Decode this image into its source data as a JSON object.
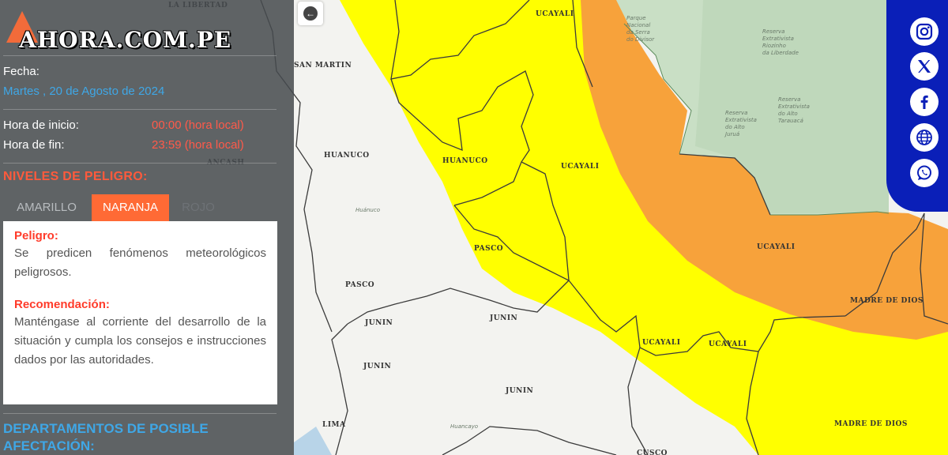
{
  "brand": {
    "logo_text": "AHORA.COM.PE"
  },
  "fecha": {
    "label": "Fecha:",
    "value": "Martes , 20 de Agosto de 2024"
  },
  "hora_inicio": {
    "label": "Hora de inicio:",
    "value": "00:00 (hora local)"
  },
  "hora_fin": {
    "label": "Hora de fin:",
    "value": "23:59 (hora local)"
  },
  "niveles": {
    "title": "NIVELES DE PELIGRO:",
    "tabs": [
      {
        "label": "AMARILLO"
      },
      {
        "label": "NARANJA"
      },
      {
        "label": "ROJO"
      }
    ],
    "active": "NARANJA"
  },
  "card": {
    "peligro_title": "Peligro:",
    "peligro_text": "Se predicen fenómenos meteorológicos peligrosos.",
    "recomendacion_title": "Recomendación:",
    "recomendacion_text": "Manténgase al corriente del desarrollo de la situación y cumpla los consejos e instrucciones dados por las autoridades."
  },
  "departamentos_title": "DEPARTAMENTOS DE POSIBLE AFECTACIÓN:",
  "map": {
    "region_labels": [
      "LA LIBERTAD",
      "SAN MARTIN",
      "ANCASH",
      "HUANUCO",
      "HUANUCO",
      "PASCO",
      "PASCO",
      "JUNIN",
      "JUNIN",
      "JUNIN",
      "JUNIN",
      "LIMA",
      "UCAYALI",
      "UCAYALI",
      "UCAYALI",
      "UCAYALI",
      "UCAYALI",
      "MADRE DE DIOS",
      "MADRE DE DIOS",
      "CUSCO"
    ],
    "small_labels": [
      "Parque Nacional da Serra do Divisor",
      "Reserva Extrativista Riozinho da Liberdade",
      "Reserva Extrativista do Alto Juruá",
      "Reserva Extrativista do Alto Tarauacá",
      "Huánuco",
      "Huancayo"
    ],
    "warning_colors": {
      "amarillo": "#ffff00",
      "naranja": "#f7a23b"
    }
  },
  "social": [
    "instagram-icon",
    "x-icon",
    "facebook-icon",
    "web-icon",
    "whatsapp-icon"
  ],
  "colors": {
    "accent_orange": "#ff6a35",
    "title_red": "#ff5a3c",
    "link_blue": "#3fa7e6",
    "social_blue": "#0a1fb8"
  }
}
